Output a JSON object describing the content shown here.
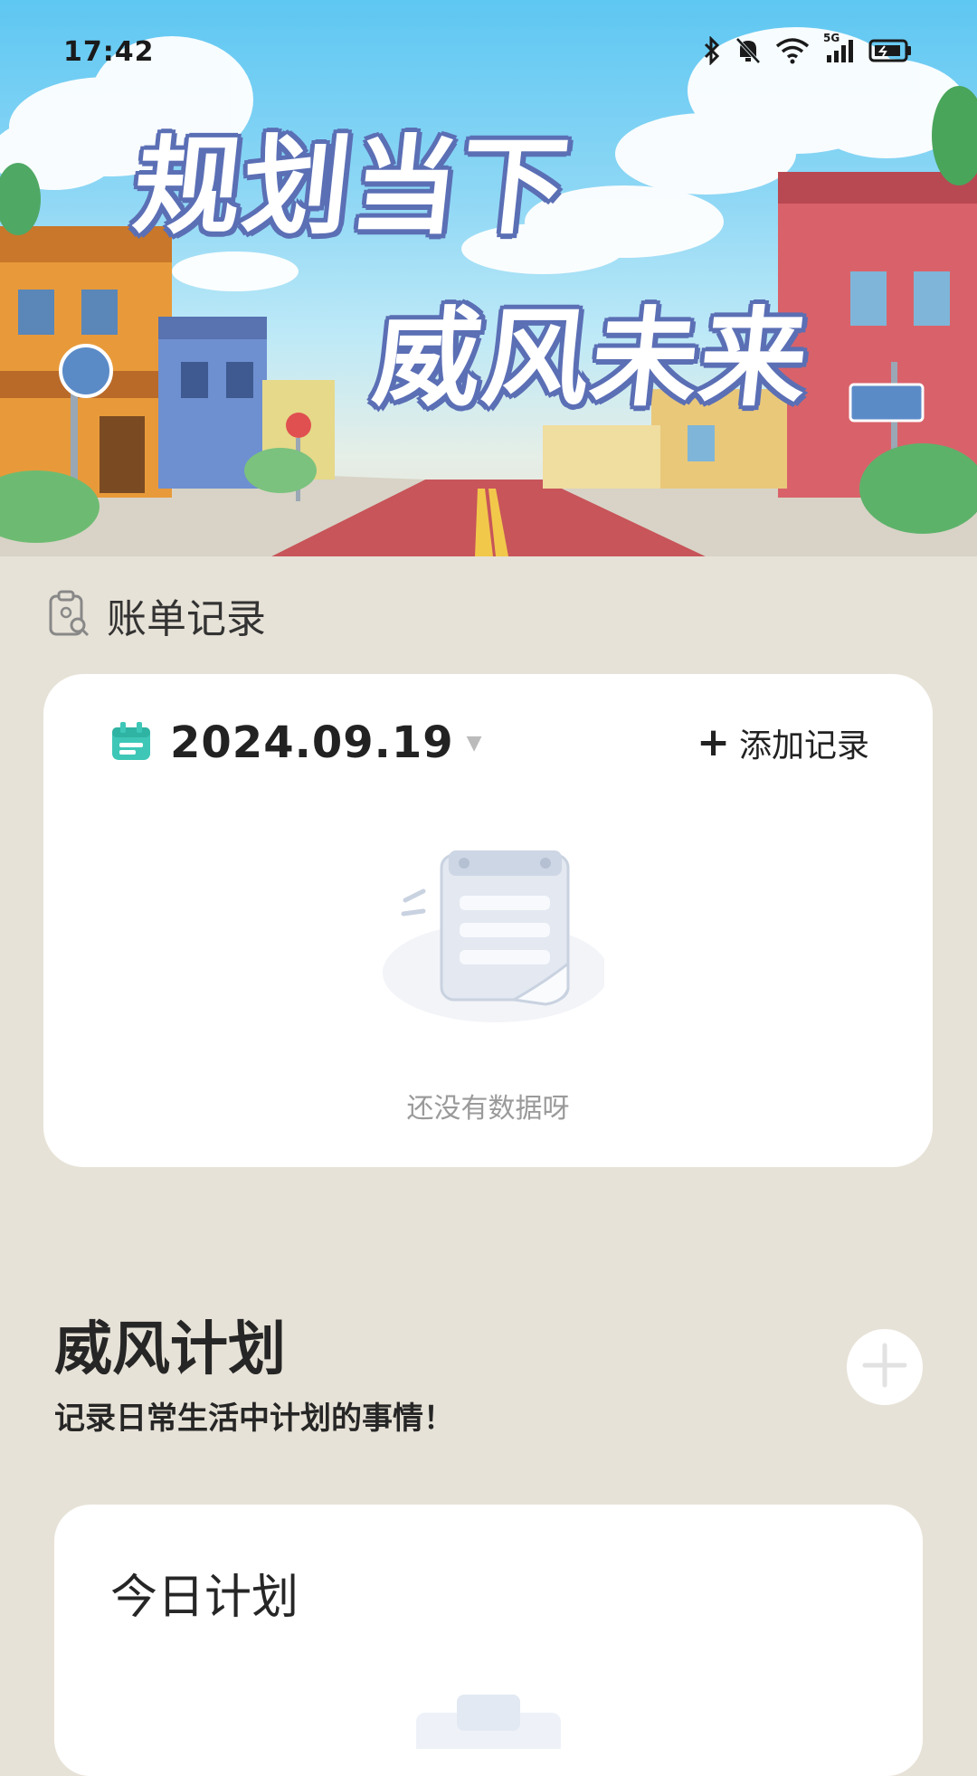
{
  "status_bar": {
    "time": "17:42",
    "network_label": "5G"
  },
  "banner": {
    "line1": "规划当下",
    "line2": "威风未来"
  },
  "bill_section": {
    "title": "账单记录",
    "date": "2024.09.19",
    "add_label": "添加记录",
    "empty_text": "还没有数据呀"
  },
  "plan_section": {
    "title": "威风计划",
    "subtitle": "记录日常生活中计划的事情！",
    "today_title": "今日计划"
  },
  "colors": {
    "background": "#E7E2D7",
    "accent_teal": "#3EC7B7",
    "slogan_outline": "#5B6FB5"
  },
  "icons": [
    "bluetooth-icon",
    "mute-bell-icon",
    "wifi-icon",
    "cellular-signal-icon",
    "battery-icon",
    "bill-clipboard-icon",
    "calendar-icon",
    "caret-down-icon",
    "plus-icon",
    "empty-document-icon",
    "circle-plus-icon"
  ]
}
